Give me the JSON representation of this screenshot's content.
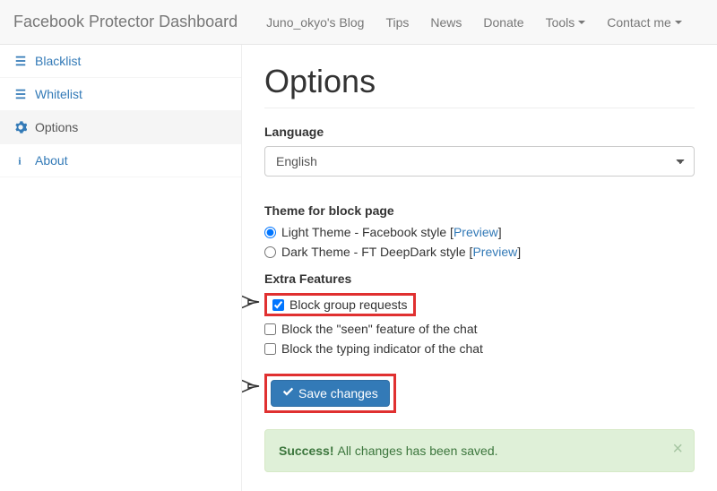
{
  "navbar": {
    "brand": "Facebook Protector Dashboard",
    "items": [
      {
        "label": "Juno_okyo's Blog",
        "has_caret": false
      },
      {
        "label": "Tips",
        "has_caret": false
      },
      {
        "label": "News",
        "has_caret": false
      },
      {
        "label": "Donate",
        "has_caret": false
      },
      {
        "label": "Tools",
        "has_caret": true
      },
      {
        "label": "Contact me",
        "has_caret": true
      }
    ]
  },
  "sidebar": {
    "items": [
      {
        "label": "Blacklist",
        "icon": "list"
      },
      {
        "label": "Whitelist",
        "icon": "list"
      },
      {
        "label": "Options",
        "icon": "gear",
        "active": true
      },
      {
        "label": "About",
        "icon": "info"
      }
    ]
  },
  "page": {
    "title": "Options",
    "language_label": "Language",
    "language_value": "English",
    "theme_label": "Theme for block page",
    "themes": [
      {
        "label": "Light Theme - Facebook style",
        "preview": "Preview",
        "checked": true
      },
      {
        "label": "Dark Theme - FT DeepDark style",
        "preview": "Preview",
        "checked": false
      }
    ],
    "extra_label": "Extra Features",
    "extras": [
      {
        "label": "Block group requests",
        "checked": true,
        "highlighted": true
      },
      {
        "label": "Block the \"seen\" feature of the chat",
        "checked": false,
        "highlighted": false
      },
      {
        "label": "Block the typing indicator of the chat",
        "checked": false,
        "highlighted": false
      }
    ],
    "save_label": "Save changes",
    "alert_strong": "Success!",
    "alert_text": "All changes has been saved."
  }
}
